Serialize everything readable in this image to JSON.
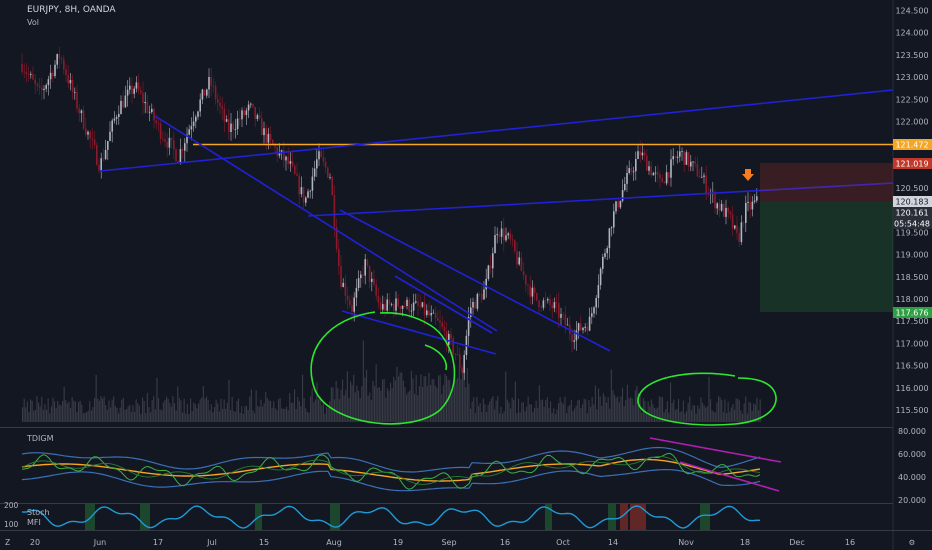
{
  "header": {
    "symbol_line": "EURJPY, 8H, OANDA",
    "volume_label": "Vol"
  },
  "main_axis": {
    "min": 115.0,
    "max": 124.8,
    "ticks": [
      "124.500",
      "124.000",
      "123.500",
      "123.000",
      "122.500",
      "122.000",
      "121.500",
      "121.000",
      "120.500",
      "120.000",
      "119.500",
      "119.000",
      "118.500",
      "118.000",
      "117.500",
      "117.000",
      "116.500",
      "116.000",
      "115.500"
    ],
    "tick_values": [
      124.5,
      124.0,
      123.5,
      123.0,
      122.5,
      122.0,
      121.5,
      121.0,
      120.5,
      120.0,
      119.5,
      119.0,
      118.5,
      118.0,
      117.5,
      117.0,
      116.5,
      116.0,
      115.5
    ]
  },
  "price_tags": {
    "orange_level": {
      "text": "121.472",
      "value": 121.472,
      "color": "#f5a623"
    },
    "red_level": {
      "text": "121.019",
      "value": 121.019,
      "color": "#c0392b"
    },
    "last_price": {
      "text": "120.183",
      "value": 120.183,
      "color": "#d1d4dc"
    },
    "bid_price": {
      "text": "120.161",
      "value": 120.161,
      "color": "#d1d4dc"
    },
    "countdown": {
      "text": "05:54:48"
    },
    "green_level": {
      "text": "117.676",
      "value": 117.676,
      "color": "#2ea043"
    }
  },
  "time_axis": {
    "labels": [
      "20",
      "Jun",
      "17",
      "Jul",
      "15",
      "Aug",
      "19",
      "Sep",
      "16",
      "Oct",
      "14",
      "Nov",
      "18",
      "Dec",
      "16"
    ]
  },
  "indicator_tdigm": {
    "label": "TDIGM",
    "ticks": [
      "80.000",
      "60.000",
      "40.000",
      "20.000"
    ],
    "tick_values": [
      80,
      60,
      40,
      20
    ]
  },
  "indicator_stoch": {
    "label1": "Stoch",
    "label2": "MFI",
    "left_ticks": [
      "200",
      "100"
    ]
  },
  "colors": {
    "background": "#131722",
    "candle_up": "#b2b5be",
    "candle_down": "#8b1a2b",
    "trendline": "#2121d6",
    "resistance": "#f5a623",
    "annotation": "#2ee62e",
    "upper_band": "#3b6fb6",
    "tdi_signal": "#f5a623",
    "tdi_price": "#3cb043",
    "channel": "#b01fb0",
    "stoch_line": "#1e9bd7"
  }
}
